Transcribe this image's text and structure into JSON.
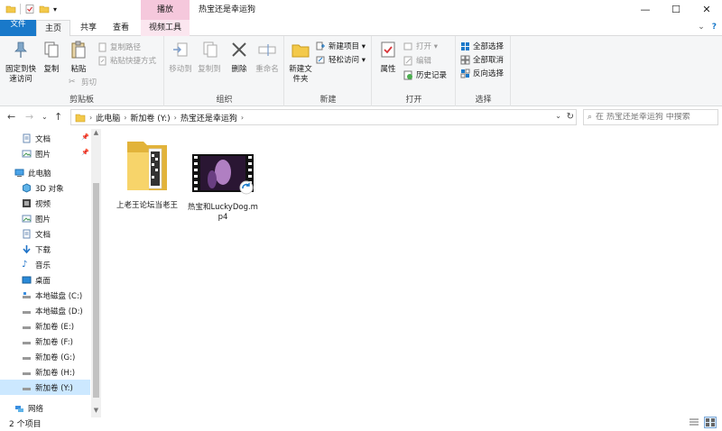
{
  "window": {
    "title": "热宝还是幸运狗",
    "context_tab_group": "播放",
    "controls": {
      "minimize": "—",
      "maximize": "☐",
      "close": "✕"
    }
  },
  "tabs": [
    {
      "label": "文件"
    },
    {
      "label": "主页"
    },
    {
      "label": "共享"
    },
    {
      "label": "查看"
    },
    {
      "label": "视频工具"
    }
  ],
  "tab_right": {
    "collapse": "⌄",
    "help": "?"
  },
  "ribbon": {
    "clipboard": {
      "label": "剪贴板",
      "pin": "固定到快速访问",
      "copy": "复制",
      "paste": "粘贴",
      "copy_path": "复制路径",
      "paste_shortcut": "粘贴快捷方式",
      "cut": "剪切"
    },
    "organize": {
      "label": "组织",
      "move_to": "移动到",
      "copy_to": "复制到",
      "delete": "删除",
      "rename": "重命名"
    },
    "new": {
      "label": "新建",
      "new_folder": "新建文件夹",
      "new_item": "新建项目 ▾",
      "easy_access": "轻松访问 ▾"
    },
    "open": {
      "label": "打开",
      "properties": "属性",
      "open": "打开 ▾",
      "edit": "编辑",
      "history": "历史记录"
    },
    "select": {
      "label": "选择",
      "select_all": "全部选择",
      "select_none": "全部取消",
      "invert": "反向选择"
    }
  },
  "address": {
    "crumbs": [
      "此电脑",
      "新加卷 (Y:)",
      "热宝还是幸运狗"
    ],
    "search_placeholder": "在 热宝还是幸运狗 中搜索"
  },
  "nav": {
    "quick": [
      {
        "label": "文档"
      },
      {
        "label": "图片"
      }
    ],
    "this_pc": "此电脑",
    "pc_items": [
      {
        "label": "3D 对象"
      },
      {
        "label": "视频"
      },
      {
        "label": "图片"
      },
      {
        "label": "文档"
      },
      {
        "label": "下载"
      },
      {
        "label": "音乐"
      },
      {
        "label": "桌面"
      },
      {
        "label": "本地磁盘 (C:)"
      },
      {
        "label": "本地磁盘 (D:)"
      },
      {
        "label": "新加卷 (E:)"
      },
      {
        "label": "新加卷 (F:)"
      },
      {
        "label": "新加卷 (G:)"
      },
      {
        "label": "新加卷 (H:)"
      },
      {
        "label": "新加卷 (Y:)"
      }
    ],
    "network": "网络"
  },
  "files": [
    {
      "name": "上老王论坛当老王",
      "type": "folder"
    },
    {
      "name": "热宝和LuckyDog.mp4",
      "type": "video"
    }
  ],
  "status": {
    "count": "2 个项目"
  },
  "colors": {
    "accent": "#1979ca",
    "context_tab": "#f5c8dc",
    "selection": "#cce8ff",
    "folder": "#f3c94a"
  }
}
